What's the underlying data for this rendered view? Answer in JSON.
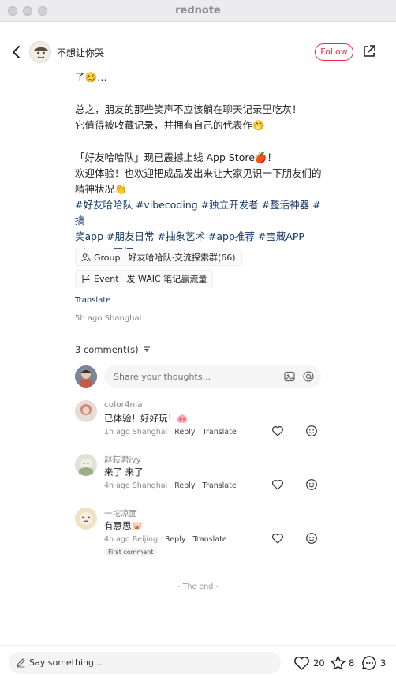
{
  "window": {
    "title": "rednote"
  },
  "header": {
    "author": "不想让你哭",
    "follow_label": "Follow"
  },
  "post": {
    "lines": [
      "了🥴…",
      "总之，朋友的那些笑声不应该躺在聊天记录里吃灰！",
      "它值得被收藏记录，并拥有自己的代表作🤭",
      "「好友哈哈队」现已震撼上线 App Store🍎！",
      "欢迎体验！也欢迎把成品发出来让大家见识一下朋友们的",
      "精神状况👏"
    ],
    "tags": [
      "#好友哈哈队",
      "#vibecoding",
      "#独立开发者",
      "#整活神器",
      "#搞笑app",
      "#朋友日常",
      "#抽象艺术",
      "#app推荐",
      "#宝藏APP",
      "#howto玩坏AI"
    ],
    "tag_lines": [
      "#好友哈哈队 #vibecoding #独立开发者 #整活神器 #搞",
      "笑app #朋友日常 #抽象艺术 #app推荐 #宝藏APP",
      "#howto玩坏AI"
    ],
    "group_chip": {
      "type": "Group",
      "label": "好友哈哈队·交流探索群(66)"
    },
    "event_chip": {
      "type": "Event",
      "label": "发 WAIC 笔记赢流量"
    },
    "translate_label": "Translate",
    "time_location": "5h ago Shanghai"
  },
  "comments_section": {
    "count_label": "3 comment(s)",
    "input_placeholder": "Share your thoughts...",
    "comments": [
      {
        "name": "color4nia",
        "text": "已体验！好好玩！🐽",
        "time": "1h ago",
        "location": "Shanghai",
        "reply": "Reply",
        "translate": "Translate"
      },
      {
        "name": "赵荻君ivy",
        "text": "来了 来了",
        "time": "4h ago",
        "location": "Shanghai",
        "reply": "Reply",
        "translate": "Translate"
      },
      {
        "name": "一坨凉面",
        "text": "有意思🐷",
        "time": "4h ago",
        "location": "Beijing",
        "reply": "Reply",
        "translate": "Translate",
        "badge": "First comment"
      }
    ],
    "end_label": "- The end -"
  },
  "bottom_bar": {
    "say_placeholder": "Say something...",
    "likes": "20",
    "stars": "8",
    "comments": "3"
  },
  "colors": {
    "brand": "#ff2442",
    "tag": "#13386c"
  }
}
